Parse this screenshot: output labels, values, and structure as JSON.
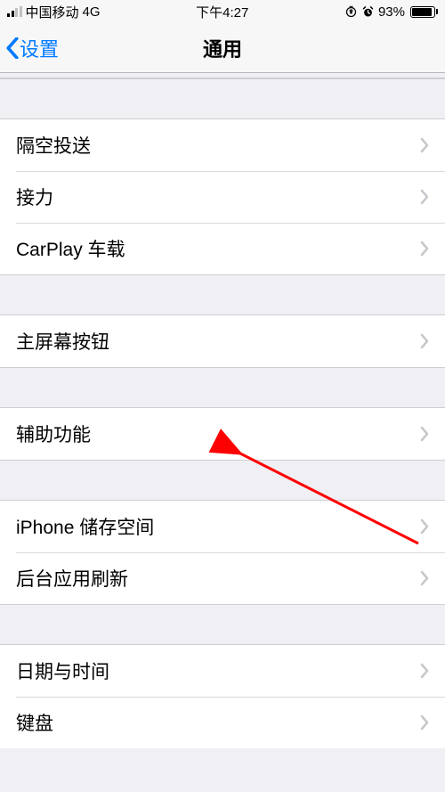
{
  "status": {
    "carrier": "中国移动",
    "network": "4G",
    "time": "下午4:27",
    "battery_pct": "93%",
    "battery_fill_pct": 93
  },
  "nav": {
    "back_label": "设置",
    "title": "通用"
  },
  "groups": [
    {
      "items": [
        {
          "key": "airdrop",
          "label": "隔空投送"
        },
        {
          "key": "handoff",
          "label": "接力"
        },
        {
          "key": "carplay",
          "label": "CarPlay 车载"
        }
      ]
    },
    {
      "items": [
        {
          "key": "homebutton",
          "label": "主屏幕按钮"
        }
      ]
    },
    {
      "items": [
        {
          "key": "accessibility",
          "label": "辅助功能"
        }
      ]
    },
    {
      "items": [
        {
          "key": "storage",
          "label": "iPhone 储存空间"
        },
        {
          "key": "bgrefresh",
          "label": "后台应用刷新"
        }
      ]
    },
    {
      "items": [
        {
          "key": "datetime",
          "label": "日期与时间"
        },
        {
          "key": "keyboard",
          "label": "键盘"
        }
      ]
    }
  ],
  "annotation": {
    "target_row": "accessibility"
  }
}
